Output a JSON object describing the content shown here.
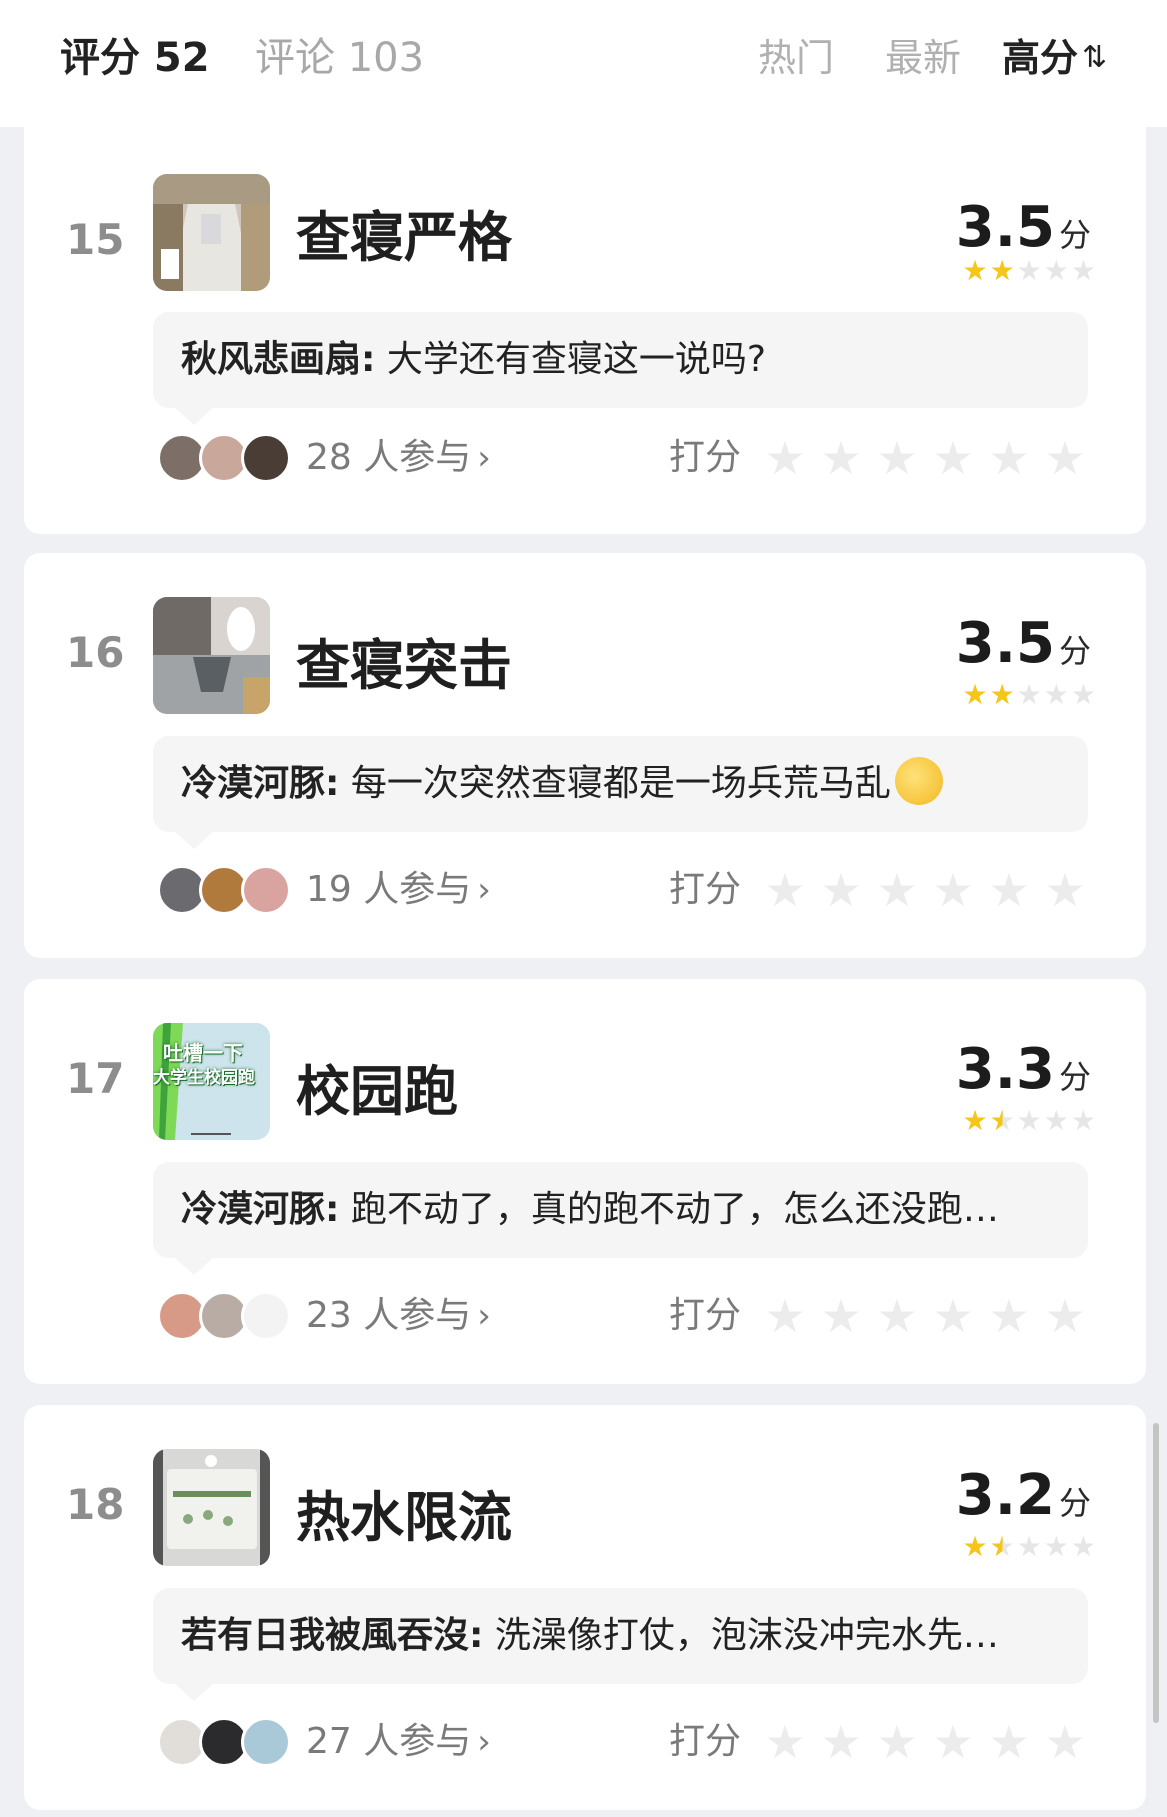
{
  "header": {
    "tab_score": "评分 52",
    "tab_comments": "评论 103",
    "sort_hot": "热门",
    "sort_new": "最新",
    "sort_high": "高分",
    "sort_icon": "⇅"
  },
  "rate_label": "打分",
  "colors": {
    "star_active": "#f5c518",
    "star_inactive": "#e6e6e6",
    "background": "#eef0f3"
  },
  "items": [
    {
      "rank": "15",
      "topic": "查寝严格",
      "score": "3.5",
      "unit": "分",
      "stars": 1.5,
      "author": "秋风悲画扇:",
      "comment": " 大学还有查寝这一说吗?",
      "participants": "28 人参与"
    },
    {
      "rank": "16",
      "topic": "查寝突击",
      "score": "3.5",
      "unit": "分",
      "stars": 1.5,
      "author": "冷漠河豚:",
      "comment": " 每一次突然查寝都是一场兵荒马乱",
      "participants": "19 人参与"
    },
    {
      "rank": "17",
      "topic": "校园跑",
      "score": "3.3",
      "unit": "分",
      "stars": 1.5,
      "author": "冷漠河豚:",
      "comment": " 跑不动了，真的跑不动了，怎么还没跑…",
      "participants": "23 人参与",
      "thumb_text_1": "吐槽一下",
      "thumb_text_2": "大学生校园跑"
    },
    {
      "rank": "18",
      "topic": "热水限流",
      "score": "3.2",
      "unit": "分",
      "stars": 1.5,
      "author": "若有日我被風吞沒:",
      "comment": " 洗澡像打仗，泡沫没冲完水先…",
      "participants": "27 人参与"
    }
  ]
}
